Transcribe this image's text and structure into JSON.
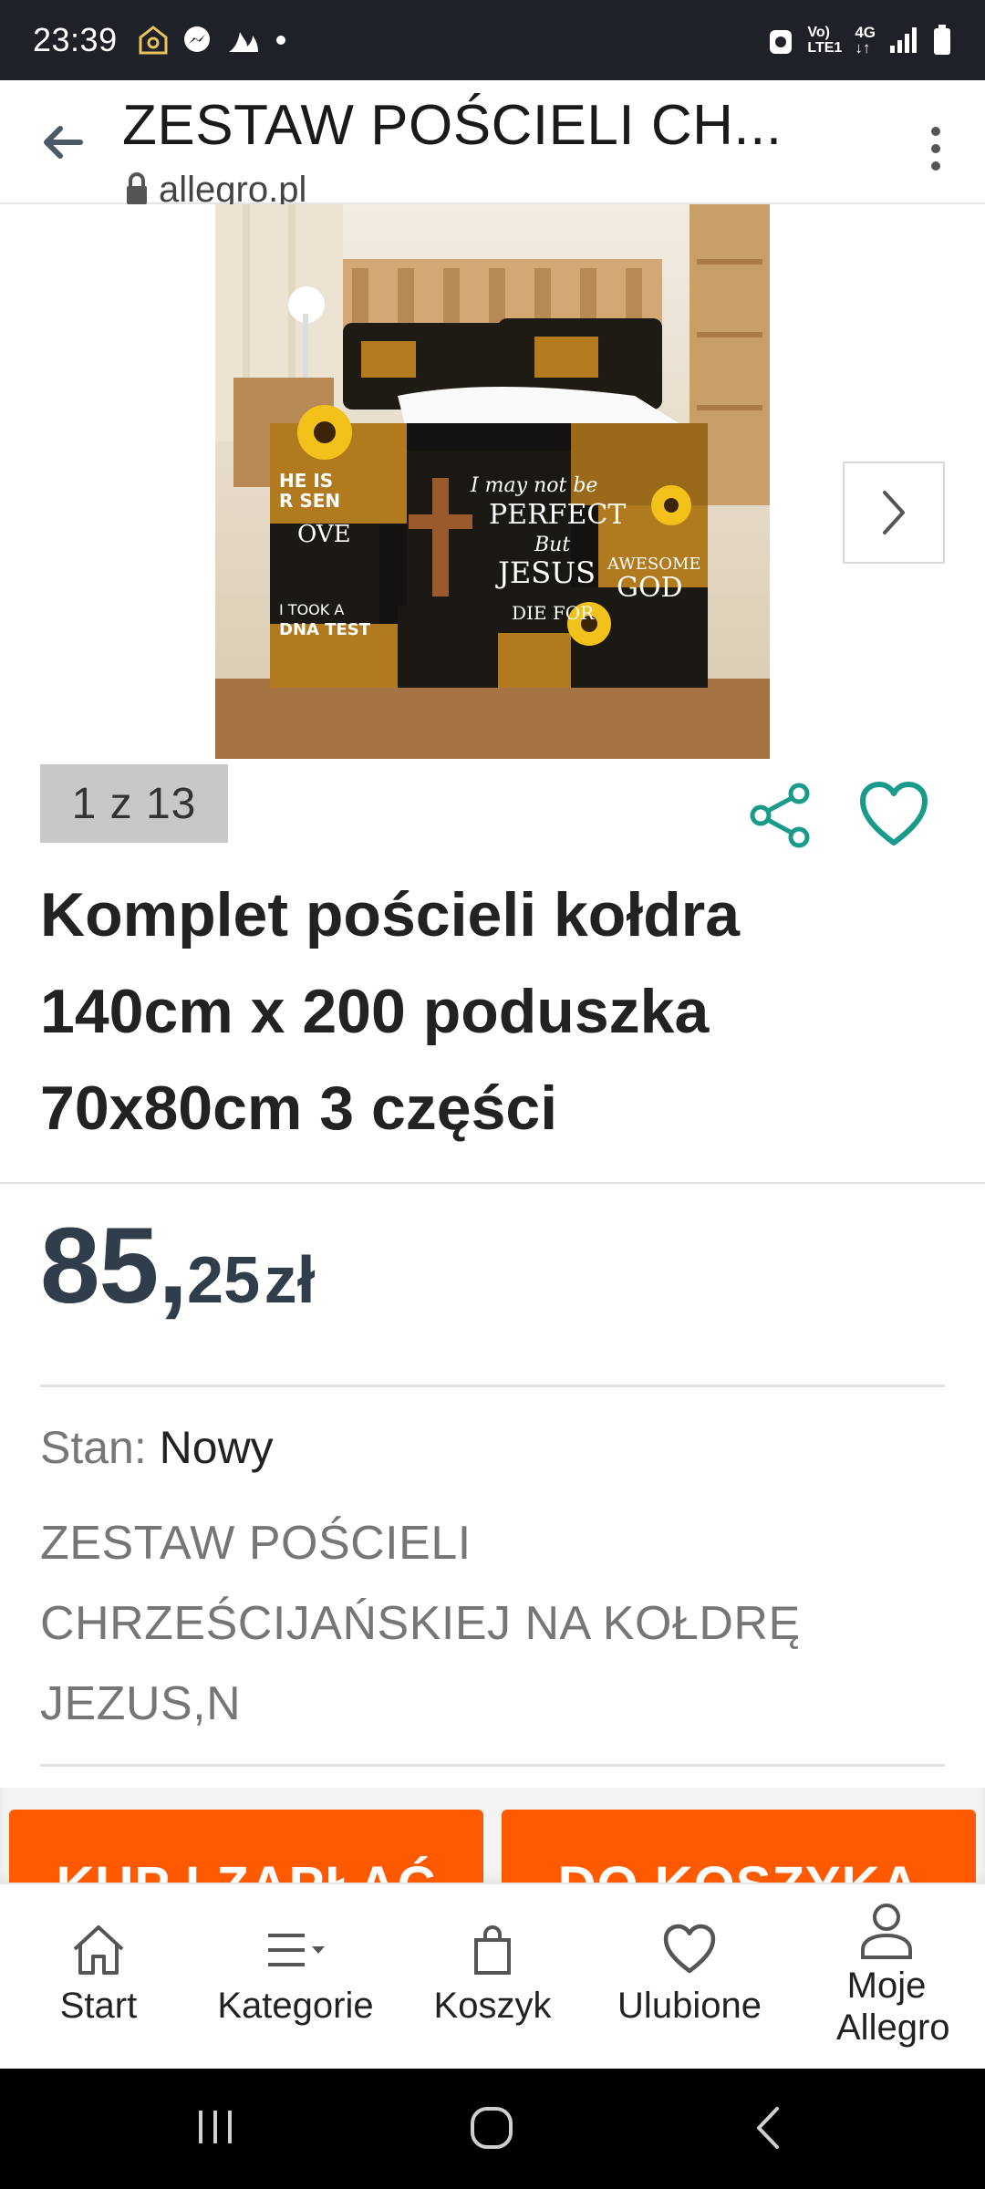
{
  "status_bar": {
    "time": "23:39",
    "net_label_1": "Vo)",
    "net_label_2": "LTE1",
    "net_type": "4G"
  },
  "browser": {
    "title": "ZESTAW POŚCIELI CH...",
    "domain": "allegro.pl"
  },
  "gallery": {
    "counter": "1 z 13"
  },
  "product": {
    "title": "Komplet pościeli kołdra 140cm x 200 poduszka 70x80cm 3 części",
    "price_main": "85,",
    "price_cents": "25",
    "price_currency": "zł",
    "condition_label": "Stan:",
    "condition_value": "Nowy",
    "description": "ZESTAW POŚCIELI CHRZEŚCIJAŃSKIEJ NA KOŁDRĘ JEZUS,N"
  },
  "actions": {
    "buy_now": "KUP I ZAPŁAĆ",
    "add_to_cart": "DO KOSZYKA"
  },
  "bottom_nav": {
    "items": [
      {
        "label": "Start",
        "icon": "home-icon"
      },
      {
        "label": "Kategorie",
        "icon": "menu-icon"
      },
      {
        "label": "Koszyk",
        "icon": "bag-icon"
      },
      {
        "label": "Ulubione",
        "icon": "heart-icon"
      },
      {
        "label": "Moje Allegro",
        "icon": "user-icon"
      }
    ]
  },
  "colors": {
    "accent": "#ff5a00",
    "teal": "#1a9a8a",
    "price": "#2f3e4a"
  }
}
